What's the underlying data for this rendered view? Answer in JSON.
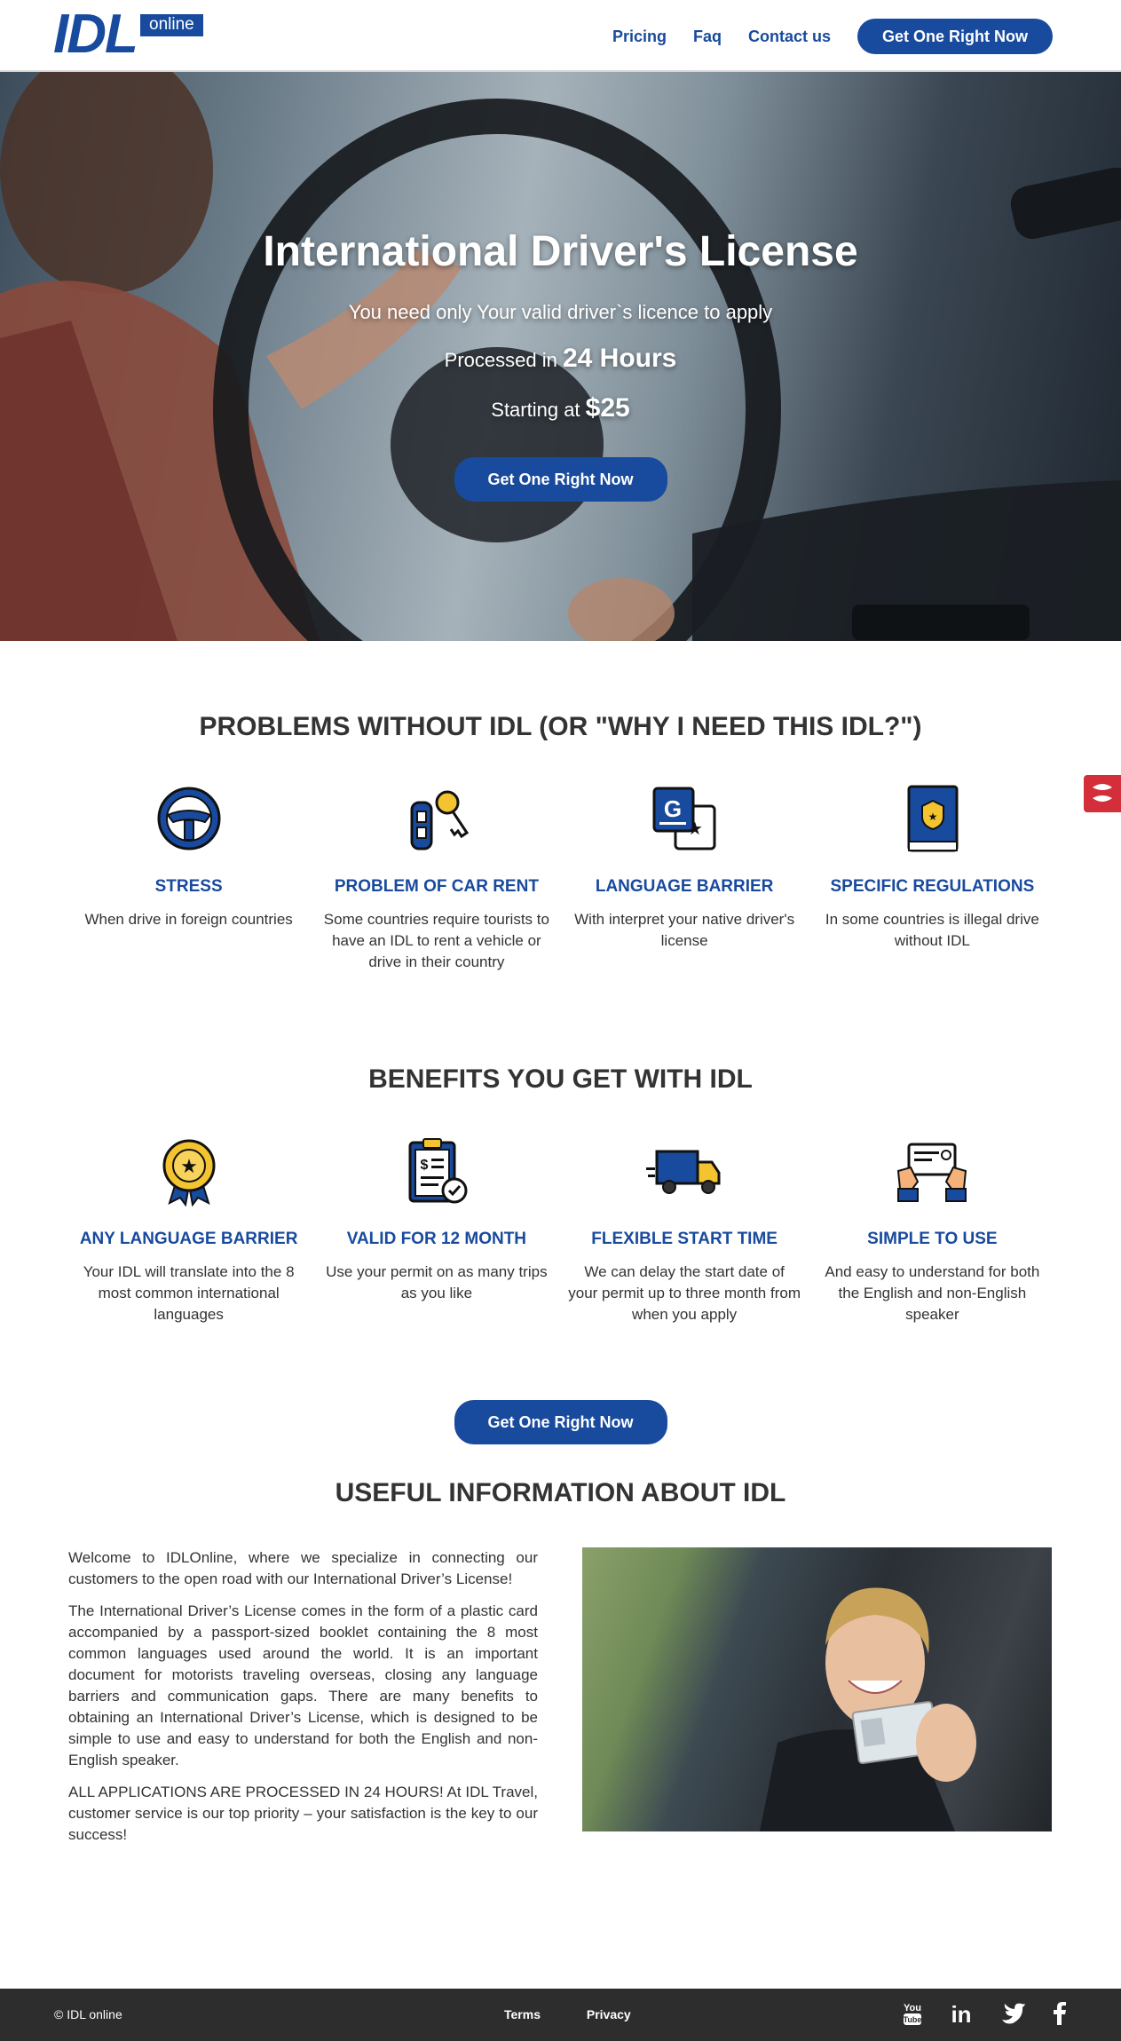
{
  "header": {
    "logo_main": "IDL",
    "logo_badge": "online",
    "nav": [
      "Pricing",
      "Faq",
      "Contact us"
    ],
    "cta": "Get One Right Now"
  },
  "hero": {
    "title": "International Driver's License",
    "subtitle": "You need only Your valid driver`s licence to apply",
    "processed_prefix": "Processed in",
    "processed_value": "24 Hours",
    "starting_prefix": "Starting at",
    "starting_value": "$25",
    "cta": "Get One Right Now"
  },
  "problems": {
    "title": "PROBLEMS WITHOUT IDL (OR \"WHY I NEED THIS IDL?\")",
    "items": [
      {
        "icon": "steering-wheel-icon",
        "title": "STRESS",
        "text": "When drive in foreign countries"
      },
      {
        "icon": "car-key-icon",
        "title": "PROBLEM OF CAR RENT",
        "text": "Some countries require tourists to have an IDL to rent a vehicle or drive in their country"
      },
      {
        "icon": "translate-icon",
        "title": "LANGUAGE BARRIER",
        "text": "With interpret your native driver's license"
      },
      {
        "icon": "rule-book-icon",
        "title": "SPECIFIC REGULATIONS",
        "text": "In some countries is illegal drive without IDL"
      }
    ]
  },
  "benefits": {
    "title": "BENEFITS YOU GET WITH IDL",
    "items": [
      {
        "icon": "award-badge-icon",
        "title": "ANY LANGUAGE BARRIER",
        "text": "Your IDL will translate into the 8 most common international languages"
      },
      {
        "icon": "clipboard-check-icon",
        "title": "VALID FOR 12 MONTH",
        "text": "Use your permit on as many trips as you like"
      },
      {
        "icon": "delivery-truck-icon",
        "title": "FLEXIBLE START TIME",
        "text": "We can delay the start date of your permit up to three month from when you apply"
      },
      {
        "icon": "hands-card-icon",
        "title": "SIMPLE TO USE",
        "text": "And easy to understand for both the English and non-English speaker"
      }
    ],
    "cta": "Get One Right Now"
  },
  "info": {
    "title": "USEFUL INFORMATION ABOUT IDL",
    "paragraphs": [
      "Welcome to IDLOnline, where we specialize in connecting our customers to the open road with our International Driver’s License!",
      "The International Driver’s License comes in the form of a plastic card accompanied by a passport-sized booklet containing the 8 most common languages used around the world. It is an important document for motorists traveling overseas, closing any language barriers and communication gaps. There are many benefits to obtaining an International Driver’s License, which is designed to be simple to use and easy to understand for both the English and non-English speaker.",
      "ALL APPLICATIONS ARE PROCESSED IN 24 HOURS! At IDL Travel, customer service is our top priority – your satisfaction is the key to our success!"
    ]
  },
  "footer": {
    "copyright": "© IDL online",
    "links": [
      "Terms",
      "Privacy"
    ],
    "social": [
      "youtube-icon",
      "linkedin-icon",
      "twitter-icon",
      "facebook-icon"
    ]
  },
  "colors": {
    "brand": "#184a9e",
    "footer": "#2d2d2d",
    "float_tab": "#d32f3a"
  }
}
